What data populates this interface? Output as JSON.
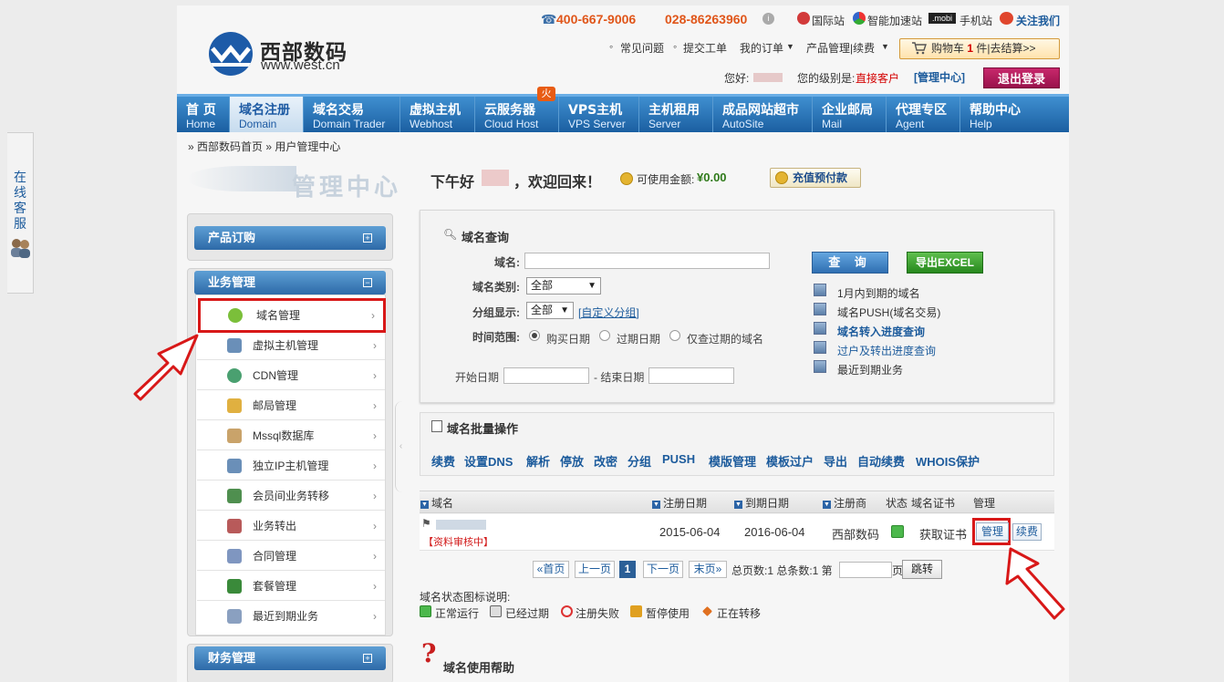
{
  "service_tab": {
    "label": "在线客服"
  },
  "header": {
    "logo_name": "西部数码",
    "logo_url": "www.west.cn",
    "phone1": "400-667-9006",
    "phone2": "028-86263960",
    "top_links": [
      "国际站",
      "智能加速站",
      "手机站",
      "关注我们"
    ],
    "nav_links": [
      "常见问题",
      "提交工单",
      "我的订单",
      "产品管理|续费"
    ],
    "cart": {
      "label_prefix": "购物车",
      "count": "1",
      "label_suffix": "件|去结算>>"
    },
    "hello": "您好:",
    "level_label": "您的级别是:",
    "level_value": "直接客户",
    "mgr_center": "[管理中心]",
    "logout": "退出登录"
  },
  "main_nav": [
    {
      "zh": "首 页",
      "en": "Home"
    },
    {
      "zh": "域名注册",
      "en": "Domain"
    },
    {
      "zh": "域名交易",
      "en": "Domain Trader"
    },
    {
      "zh": "虚拟主机",
      "en": "Webhost"
    },
    {
      "zh": "云服务器",
      "en": "Cloud Host"
    },
    {
      "zh": "VPS主机",
      "en": "VPS Server"
    },
    {
      "zh": "主机租用",
      "en": "Server"
    },
    {
      "zh": "成品网站超市",
      "en": "AutoSite"
    },
    {
      "zh": "企业邮局",
      "en": "Mail"
    },
    {
      "zh": "代理专区",
      "en": "Agent"
    },
    {
      "zh": "帮助中心",
      "en": "Help"
    }
  ],
  "hot_badge": "火",
  "breadcrumb": "» 西部数码首页  » 用户管理中心",
  "sidebar": {
    "title": "管理中心",
    "groups": [
      "产品订购",
      "业务管理",
      "财务管理"
    ],
    "items": [
      {
        "label": "域名管理",
        "color": "#7bbf3a"
      },
      {
        "label": "虚拟主机管理",
        "color": "#6a8fb8"
      },
      {
        "label": "CDN管理",
        "color": "#4aa070"
      },
      {
        "label": "邮局管理",
        "color": "#e0b040"
      },
      {
        "label": "Mssql数据库",
        "color": "#c9a36a"
      },
      {
        "label": "独立IP主机管理",
        "color": "#6a8fb8"
      },
      {
        "label": "会员间业务转移",
        "color": "#4f8f4f"
      },
      {
        "label": "业务转出",
        "color": "#b85a5a"
      },
      {
        "label": "合同管理",
        "color": "#7f96c0"
      },
      {
        "label": "套餐管理",
        "color": "#3a8a3a"
      },
      {
        "label": "最近到期业务",
        "color": "#8aa0c0"
      }
    ]
  },
  "welcome": {
    "greet": "下午好",
    "tail": "，欢迎回来！",
    "balance_label": "可使用金额:",
    "balance_value": "¥0.00",
    "recharge": "充值预付款"
  },
  "query": {
    "title": "域名查询",
    "domain_label": "域名:",
    "type_label": "域名类别:",
    "type_value": "全部",
    "group_label": "分组显示:",
    "group_value": "全部",
    "custom_group": "[自定义分组]",
    "range_label": "时间范围:",
    "radios": [
      "购买日期",
      "过期日期",
      "仅查过期的域名"
    ],
    "start_label": "开始日期",
    "end_label": "- 结束日期",
    "btn_query": "查 询",
    "btn_export": "导出EXCEL",
    "quick_links": [
      "1月内到期的域名",
      "域名PUSH(域名交易)",
      "域名转入进度查询",
      "过户及转出进度查询",
      "最近到期业务"
    ]
  },
  "batch": {
    "title": "域名批量操作",
    "actions": [
      "续费",
      "设置DNS",
      "解析",
      "停放",
      "改密",
      "分组",
      "PUSH",
      "模版管理",
      "模板过户",
      "导出",
      "自动续费",
      "WHOIS保护"
    ]
  },
  "table": {
    "columns": [
      "域名",
      "注册日期",
      "到期日期",
      "注册商",
      "状态",
      "域名证书",
      "管理"
    ],
    "rows": [
      {
        "status_note": "【资料审核中】",
        "reg_date": "2015-06-04",
        "exp_date": "2016-06-04",
        "registrar": "西部数码",
        "cert": "获取证书",
        "manage": "管理",
        "renew": "续费"
      }
    ]
  },
  "pager": {
    "first": "«首页",
    "prev": "上一页",
    "current": "1",
    "next": "下一页",
    "last": "末页»",
    "totals": "总页数:1 总条数:1 第",
    "page_unit": "页",
    "go": "跳转"
  },
  "legend": {
    "title": "域名状态图标说明:",
    "items": [
      "正常运行",
      "已经过期",
      "注册失败",
      "暂停使用",
      "正在转移"
    ]
  },
  "help": {
    "title": "域名使用帮助"
  },
  "colors": {
    "nav": "#1b5fa1",
    "highlight": "#d81818",
    "price": "#2f7a1a"
  }
}
